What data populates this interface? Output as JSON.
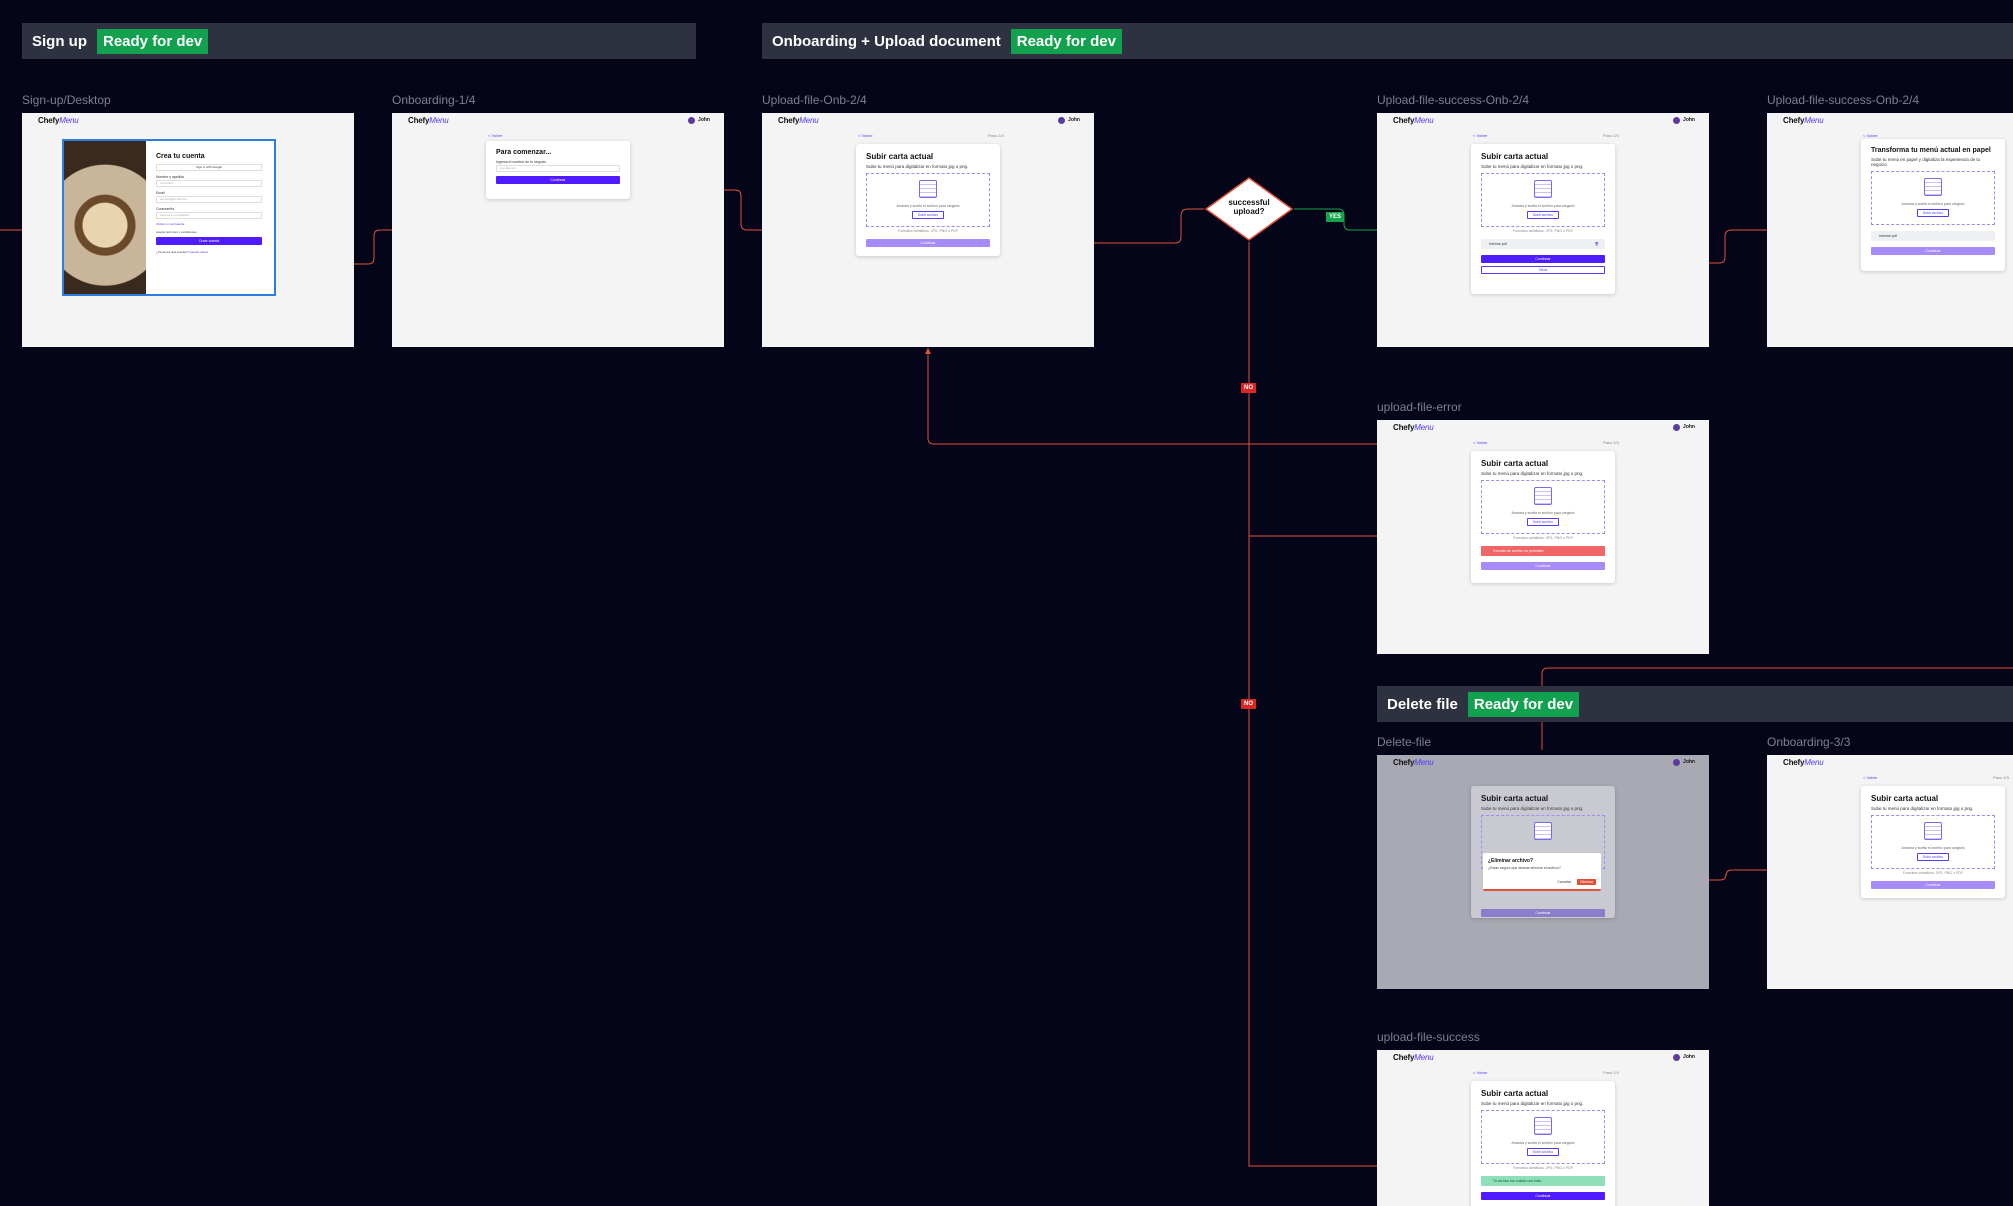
{
  "sections": {
    "signup": {
      "title": "Sign up",
      "badge": "Ready for dev"
    },
    "onboarding": {
      "title": "Onboarding + Upload document",
      "badge": "Ready for dev"
    },
    "delete": {
      "title": "Delete file",
      "badge": "Ready for dev"
    }
  },
  "frames": {
    "signup_desktop": "Sign-up/Desktop",
    "onboarding_1": "Onboarding-1/4",
    "upload_onb_2": "Upload-file-Onb-2/4",
    "upload_success_onb_2a": "Upload-file-success-Onb-2/4",
    "upload_success_onb_2b": "Upload-file-success-Onb-2/4",
    "upload_error": "upload-file-error",
    "delete_file": "Delete-file",
    "onboarding_3": "Onboarding-3/3",
    "upload_success": "upload-file-success"
  },
  "app": {
    "logo_a": "Chefy",
    "logo_b": "Menu",
    "user": "John",
    "back": "< Volver",
    "step": "Paso 2/4",
    "step3": "Paso 3/3"
  },
  "signup": {
    "title": "Crea tu cuenta",
    "google": "Sign in with Google",
    "name_label": "Nombre y apellido",
    "name_ph": "Juan Ruiz",
    "email_label": "Email",
    "email_ph": "ejemplo@email.com",
    "pass_label": "Contraseña",
    "pass_ph": "Ingresa tu contraseña",
    "forgot": "Olvidé mi contraseña",
    "terms": "Acepto términos y condiciones",
    "cta": "Crear cuenta",
    "have_account": "¿Ya tienes una cuenta?",
    "login": "Ingresar ahora"
  },
  "onboarding1": {
    "title": "Para comenzar...",
    "label": "Ingresa el nombre de tu negocio",
    "placeholder": "Los Álamos",
    "cta": "Continuar"
  },
  "upload": {
    "title": "Subir carta actual",
    "subtitle": "Sube tu menú para digitalizar en formato jpg o png.",
    "drop_text": "Arrastra y suelta el archivo para cargarlo",
    "drop_btn": "Subir archivo",
    "hint": "Formatos admitidos: JPG, PNG o PDF",
    "cta": "Continuar",
    "filename": "Informe.pdf",
    "other": "Otros",
    "error": "Formato de archivo no permitido",
    "success": "Tu archivo fue subido con éxito",
    "transform_title": "Transforma tu menú actual en papel",
    "transform_sub": "Sube tu menú en papel y digitaliza la experiencia de tu negocio",
    "delete_title": "¿Eliminar archivo?",
    "delete_text": "¿Estás seguro que deseas eliminar el archivo?",
    "cancel": "Cancelar",
    "delete": "Eliminar"
  },
  "decision": {
    "line1": "successful",
    "line2": "upload?",
    "yes": "YES",
    "no1": "NO",
    "no2": "NO"
  },
  "colors": {
    "background": "#05051a",
    "connector": "#e0513a",
    "yes_connector": "#16a34a",
    "badge": "#12a14e",
    "brand": "#4f1bff"
  }
}
